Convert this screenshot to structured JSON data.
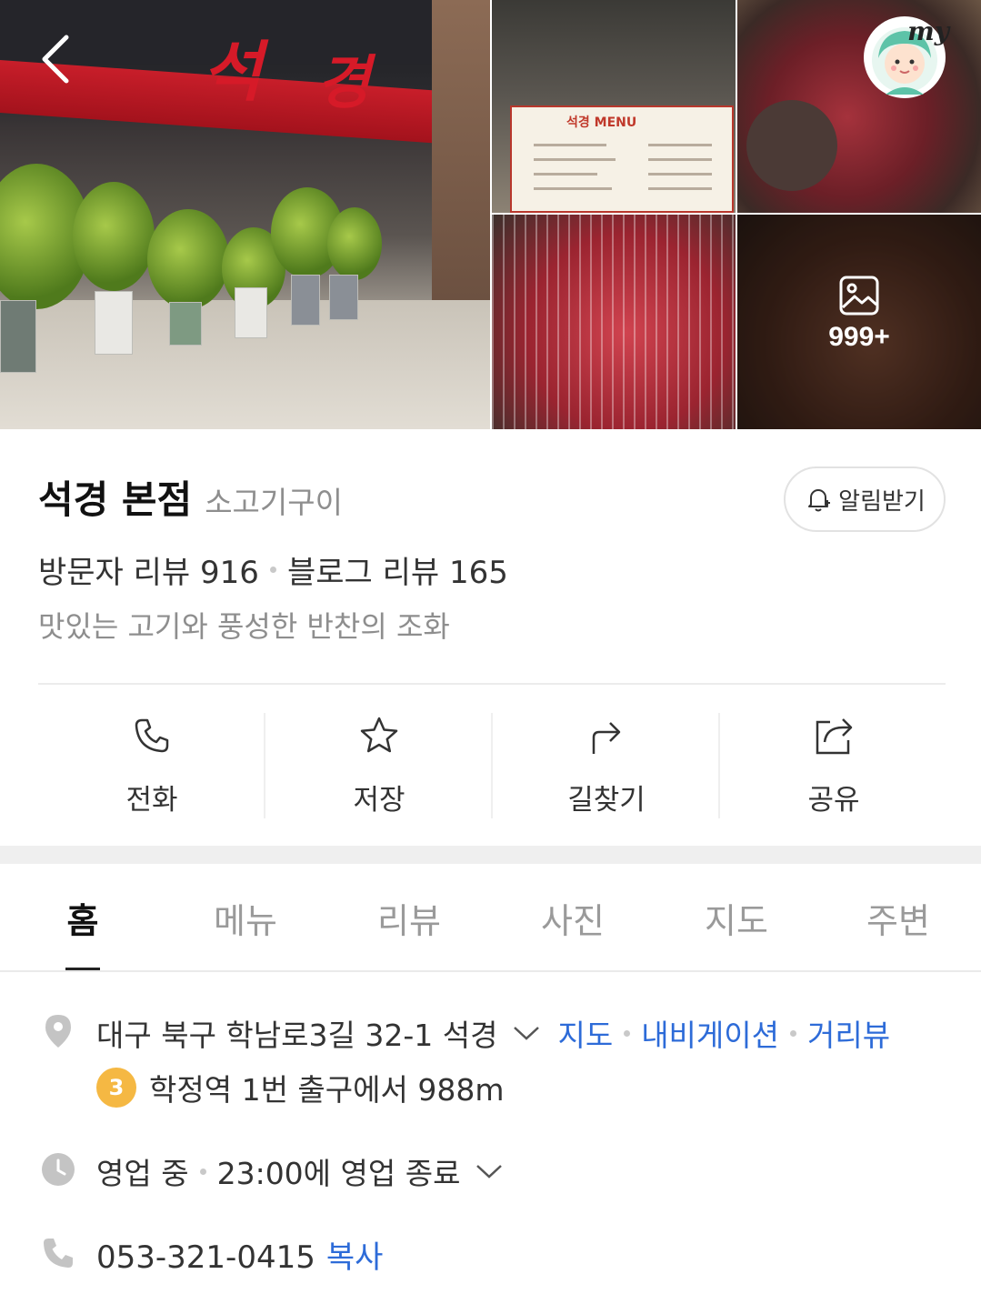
{
  "photos": {
    "more_count": "999+"
  },
  "header": {
    "my_label": "my"
  },
  "place": {
    "name": "석경 본점",
    "category": "소고기구이",
    "notify_label": "알림받기",
    "visitor_review_label": "방문자 리뷰",
    "visitor_review_count": "916",
    "blog_review_label": "블로그 리뷰",
    "blog_review_count": "165",
    "description": "맛있는 고기와 풍성한 반찬의 조화"
  },
  "actions": [
    {
      "label": "전화",
      "icon": "phone-icon"
    },
    {
      "label": "저장",
      "icon": "star-icon"
    },
    {
      "label": "길찾기",
      "icon": "directions-icon"
    },
    {
      "label": "공유",
      "icon": "share-icon"
    }
  ],
  "tabs": [
    {
      "label": "홈",
      "active": true
    },
    {
      "label": "메뉴",
      "active": false
    },
    {
      "label": "리뷰",
      "active": false
    },
    {
      "label": "사진",
      "active": false
    },
    {
      "label": "지도",
      "active": false
    },
    {
      "label": "주변",
      "active": false
    }
  ],
  "info": {
    "address": "대구 북구 학남로3길 32-1 석경",
    "address_links": [
      "지도",
      "내비게이션",
      "거리뷰"
    ],
    "subway_line": "3",
    "subway_text": "학정역 1번 출구에서 988m",
    "status": "영업 중",
    "hours_text": "23:00에 영업 종료",
    "phone": "053-321-0415",
    "copy_label": "복사"
  },
  "colors": {
    "link": "#2d6bd8",
    "subway_line_3": "#f5b843",
    "icon_gray": "#c4c4c4"
  }
}
